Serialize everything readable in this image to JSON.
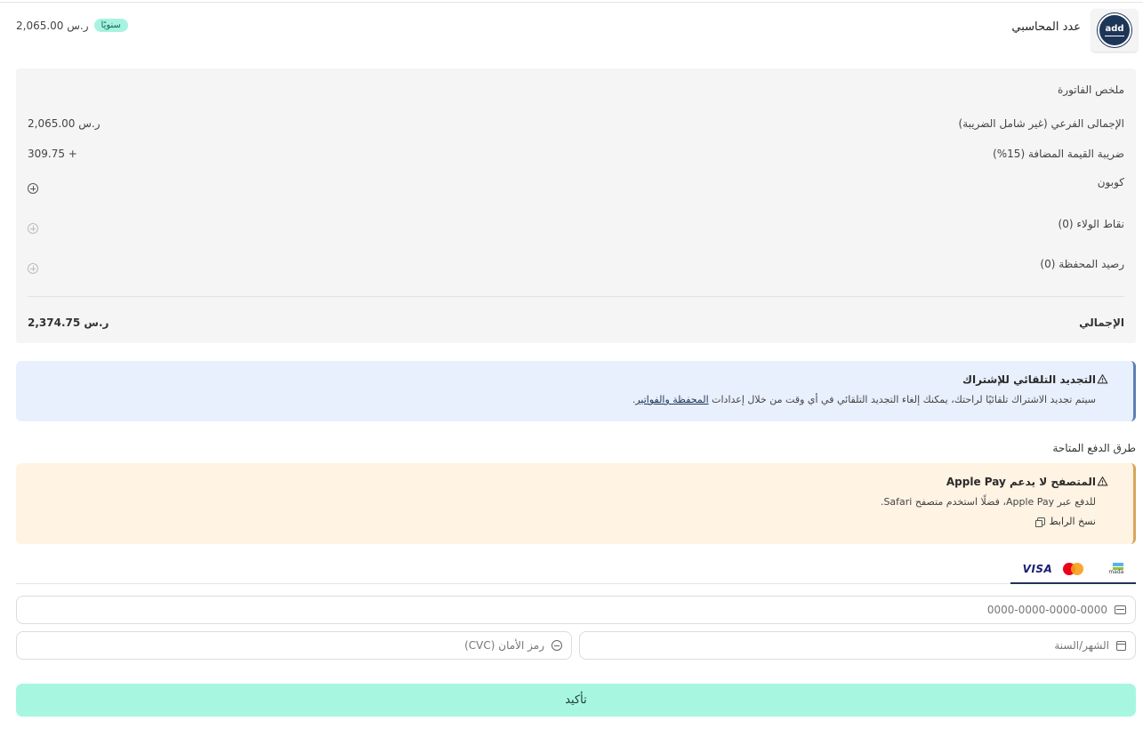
{
  "header": {
    "logo_text": "add",
    "product_name": "عدد المحاسبي",
    "billing_badge": "سنويًا",
    "price": "2,065.00 ر.س"
  },
  "summary": {
    "title": "ملخص الفاتورة",
    "subtotal_label": "الإجمالى الفرعي (غير شامل الضريبة)",
    "subtotal_value": "2,065.00 ر.س",
    "vat_label": "ضريبة القيمة المضافة (15%)",
    "vat_value": "309.75 +",
    "coupon_label": "كوبون",
    "loyalty_label": "نقاط الولاء (0)",
    "wallet_label": "رصيد المحفظة (0)",
    "total_label": "الإجمالي",
    "total_value": "2,374.75 ر.س"
  },
  "auto_renew": {
    "title": "التجديد التلقائي للإشتراك",
    "text": "سيتم تجديد الاشتراك تلقائيًا لراحتك، يمكنك إلغاء التجديد التلقائي في أي وقت من خلال إعدادات",
    "link": "المحفظة والفواتير",
    "end": "."
  },
  "payment_methods": {
    "title": "طرق الدفع المتاحة",
    "applepay_warning_title": "المتصفح لا يدعم Apple Pay",
    "applepay_warning_text": "للدفع عبر Apple Pay، فضلًا استخدم متصفح Safari.",
    "copy_link": "نسخ الرابط",
    "card_brands": {
      "mada": "mada",
      "visa": "VISA"
    }
  },
  "card_form": {
    "card_number_placeholder": "0000-0000-0000-0000",
    "expiry_placeholder": "الشهر/السنة",
    "cvc_placeholder": "رمز الأمان (CVC)"
  },
  "confirm_label": "تأكيد",
  "colors": {
    "accent": "#a7f7e0",
    "badge": "#a7f3e0",
    "info_bg": "#e8f0fd",
    "warn_bg": "#fff3e3",
    "brand_dark": "#1d3557"
  }
}
